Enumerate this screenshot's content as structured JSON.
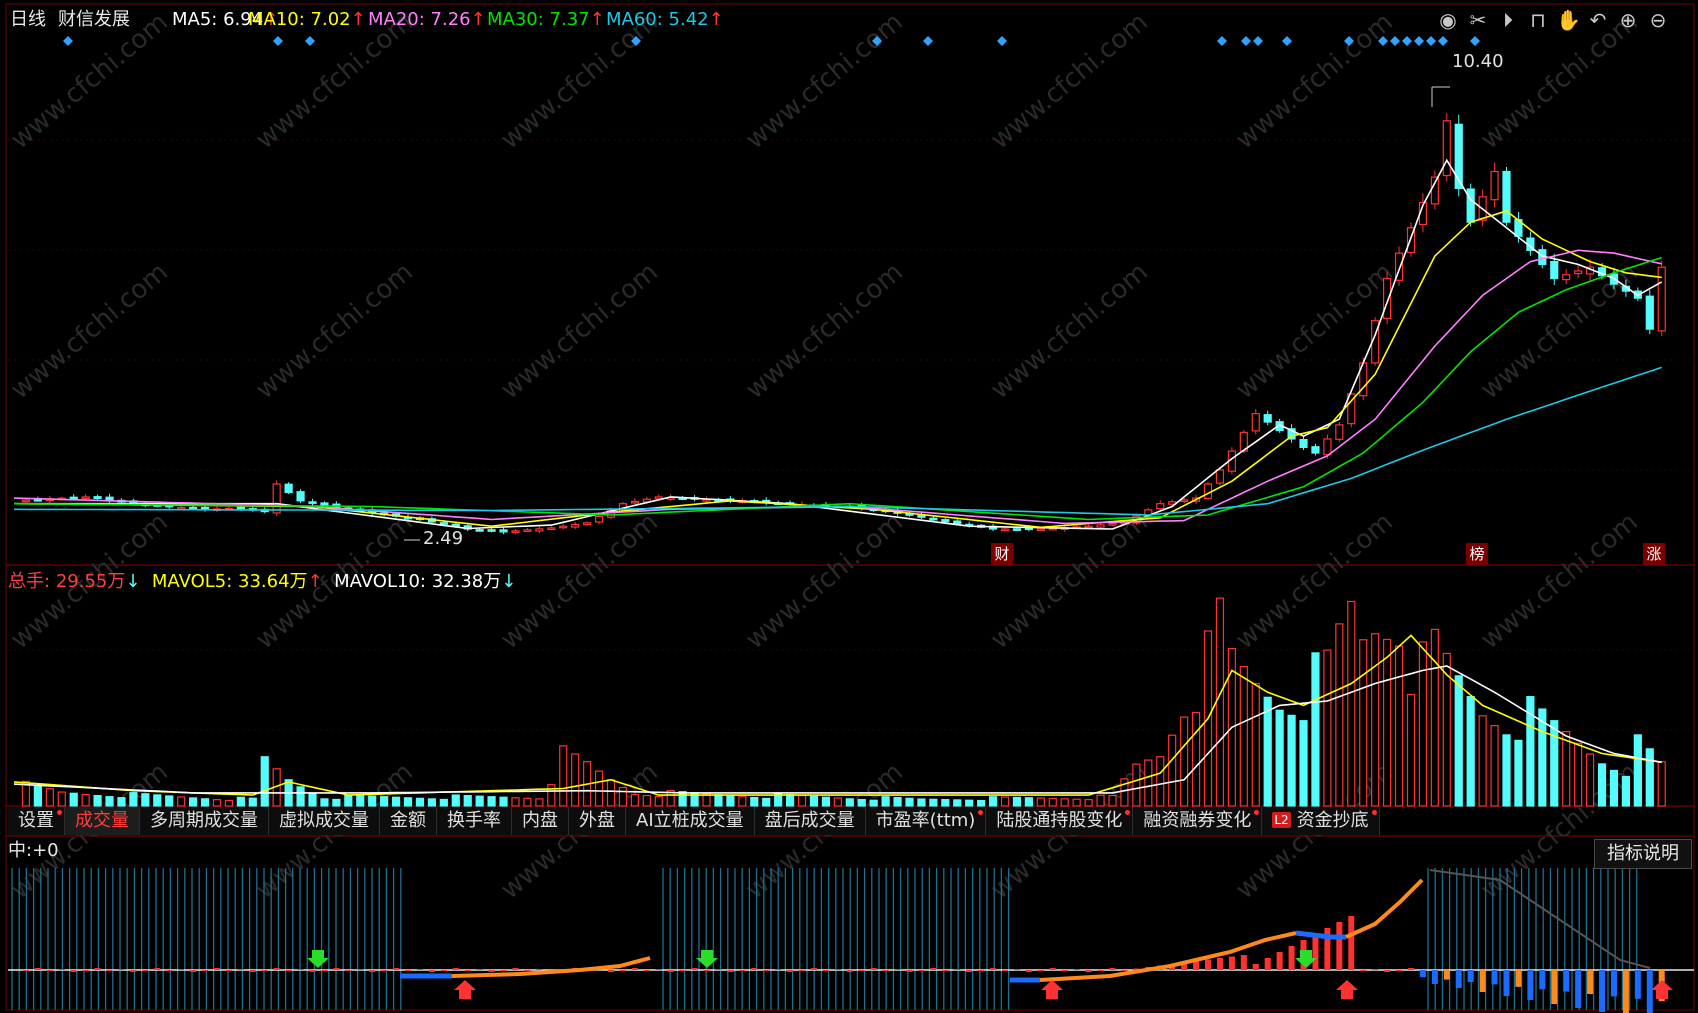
{
  "header": {
    "period": "日线",
    "stock_name": "财信发展",
    "ma5_label": "MA5:",
    "ma5_value": "6.94",
    "ma5_arrow": "↑",
    "ma10_label": "MA10:",
    "ma10_value": "7.02",
    "ma10_arrow": "↑",
    "ma20_label": "MA20:",
    "ma20_value": "7.26",
    "ma20_arrow": "↑",
    "ma30_label": "MA30:",
    "ma30_value": "7.37",
    "ma30_arrow": "↑",
    "ma60_label": "MA60:",
    "ma60_value": "5.42",
    "ma60_arrow": "↑"
  },
  "toolbar": [
    "eye-icon",
    "scissors-icon",
    "play-icon",
    "lock-icon",
    "hand-icon",
    "undo-icon",
    "zoom-in-icon",
    "zoom-out-icon"
  ],
  "price_panel": {
    "high_label": "10.40",
    "low_label": "2.49",
    "badge_cai": "财",
    "badge_bang": "榜",
    "badge_zhang": "涨"
  },
  "volume_header": {
    "total_label": "总手:",
    "total_value": "29.55万",
    "total_arrow": "↓",
    "mavol5_label": "MAVOL5:",
    "mavol5_value": "33.64万",
    "mavol5_arrow": "↑",
    "mavol10_label": "MAVOL10:",
    "mavol10_value": "32.38万",
    "mavol10_arrow": "↓"
  },
  "tabs": [
    {
      "label": "设置",
      "dot": true
    },
    {
      "label": "成交量",
      "active": true
    },
    {
      "label": "多周期成交量"
    },
    {
      "label": "虚拟成交量"
    },
    {
      "label": "金额"
    },
    {
      "label": "换手率"
    },
    {
      "label": "内盘"
    },
    {
      "label": "外盘"
    },
    {
      "label": "AI立桩成交量"
    },
    {
      "label": "盘后成交量"
    },
    {
      "label": "市盈率(ttm)",
      "dot": true
    },
    {
      "label": "陆股通持股变化",
      "dot": true
    },
    {
      "label": "融资融券变化",
      "dot": true
    },
    {
      "label": "资金抄底",
      "dot": true,
      "l2": "L2"
    }
  ],
  "indicator": {
    "label": "中:",
    "value": "+0",
    "explain_button": "指标说明"
  },
  "colors": {
    "up": "#ff3232",
    "down": "#54fcfc",
    "ma5": "#ffffff",
    "ma10": "#ffff00",
    "ma20": "#ff80ff",
    "ma30": "#00e600",
    "ma60": "#1ec8e6",
    "diamond": "#2fa4ff",
    "signal_orange": "#ff8a1c",
    "signal_blue": "#1a6cff"
  },
  "chart_data": {
    "type": "candlestick",
    "ohlc_keyframes": [
      [
        0,
        3.05
      ],
      [
        6,
        3.12
      ],
      [
        12,
        2.96
      ],
      [
        16,
        2.9
      ],
      [
        19,
        2.92
      ],
      [
        21,
        2.86
      ],
      [
        22,
        3.35
      ],
      [
        24,
        3.05
      ],
      [
        28,
        2.9
      ],
      [
        34,
        2.72
      ],
      [
        38,
        2.55
      ],
      [
        41,
        2.5
      ],
      [
        45,
        2.57
      ],
      [
        48,
        2.66
      ],
      [
        51,
        3.0
      ],
      [
        54,
        3.12
      ],
      [
        57,
        3.08
      ],
      [
        61,
        3.05
      ],
      [
        66,
        2.98
      ],
      [
        70,
        2.95
      ],
      [
        75,
        2.8
      ],
      [
        78,
        2.68
      ],
      [
        82,
        2.55
      ],
      [
        86,
        2.55
      ],
      [
        90,
        2.6
      ],
      [
        93,
        2.67
      ],
      [
        96,
        3.0
      ],
      [
        99,
        3.1
      ],
      [
        101,
        3.6
      ],
      [
        104,
        4.6
      ],
      [
        106,
        4.3
      ],
      [
        108,
        4.0
      ],
      [
        109,
        3.9
      ],
      [
        111,
        4.4
      ],
      [
        113,
        5.5
      ],
      [
        115,
        7.0
      ],
      [
        117,
        7.9
      ],
      [
        119,
        8.8
      ],
      [
        120,
        9.8
      ],
      [
        121,
        8.6
      ],
      [
        122,
        8.0
      ],
      [
        124,
        8.9
      ],
      [
        125,
        8.0
      ],
      [
        127,
        7.5
      ],
      [
        129,
        7.0
      ],
      [
        132,
        7.2
      ],
      [
        134,
        6.9
      ],
      [
        136,
        6.65
      ],
      [
        137,
        6.1
      ],
      [
        138,
        7.2
      ]
    ],
    "n_bars": 138,
    "price_range": [
      2.0,
      11.2
    ],
    "labels": {
      "max": 10.4,
      "min": 2.49
    },
    "ma_lines": {
      "MA5": [
        [
          0,
          3.0
        ],
        [
          22,
          3.0
        ],
        [
          38,
          2.56
        ],
        [
          45,
          2.62
        ],
        [
          55,
          3.12
        ],
        [
          65,
          3.0
        ],
        [
          80,
          2.6
        ],
        [
          92,
          2.55
        ],
        [
          97,
          2.95
        ],
        [
          102,
          3.8
        ],
        [
          106,
          4.4
        ],
        [
          108,
          4.2
        ],
        [
          111,
          4.5
        ],
        [
          114,
          6.0
        ],
        [
          118,
          8.3
        ],
        [
          120,
          9.1
        ],
        [
          122,
          8.4
        ],
        [
          125,
          7.9
        ],
        [
          128,
          7.4
        ],
        [
          131,
          7.25
        ],
        [
          134,
          7.0
        ],
        [
          136,
          6.7
        ],
        [
          138,
          6.94
        ]
      ],
      "MA10": [
        [
          0,
          3.0
        ],
        [
          25,
          2.95
        ],
        [
          40,
          2.6
        ],
        [
          50,
          2.85
        ],
        [
          60,
          3.05
        ],
        [
          72,
          2.9
        ],
        [
          86,
          2.58
        ],
        [
          96,
          2.75
        ],
        [
          102,
          3.4
        ],
        [
          107,
          4.2
        ],
        [
          110,
          4.35
        ],
        [
          114,
          5.3
        ],
        [
          119,
          7.4
        ],
        [
          122,
          8.0
        ],
        [
          125,
          8.2
        ],
        [
          128,
          7.7
        ],
        [
          132,
          7.3
        ],
        [
          135,
          7.1
        ],
        [
          138,
          7.02
        ]
      ],
      "MA20": [
        [
          0,
          3.1
        ],
        [
          25,
          2.95
        ],
        [
          40,
          2.72
        ],
        [
          55,
          2.9
        ],
        [
          70,
          2.95
        ],
        [
          88,
          2.65
        ],
        [
          98,
          2.7
        ],
        [
          105,
          3.4
        ],
        [
          110,
          3.85
        ],
        [
          114,
          4.5
        ],
        [
          119,
          5.8
        ],
        [
          123,
          6.7
        ],
        [
          127,
          7.3
        ],
        [
          131,
          7.5
        ],
        [
          134,
          7.45
        ],
        [
          138,
          7.26
        ]
      ],
      "MA30": [
        [
          0,
          3.0
        ],
        [
          30,
          2.95
        ],
        [
          50,
          2.8
        ],
        [
          70,
          3.0
        ],
        [
          90,
          2.72
        ],
        [
          100,
          2.8
        ],
        [
          108,
          3.3
        ],
        [
          113,
          3.9
        ],
        [
          118,
          4.8
        ],
        [
          122,
          5.7
        ],
        [
          126,
          6.4
        ],
        [
          130,
          6.8
        ],
        [
          134,
          7.1
        ],
        [
          138,
          7.37
        ]
      ],
      "MA60": [
        [
          0,
          2.9
        ],
        [
          40,
          2.88
        ],
        [
          70,
          2.95
        ],
        [
          95,
          2.8
        ],
        [
          105,
          3.0
        ],
        [
          112,
          3.45
        ],
        [
          118,
          3.95
        ],
        [
          125,
          4.5
        ],
        [
          132,
          5.0
        ],
        [
          138,
          5.42
        ]
      ]
    },
    "volume_keyframes": [
      [
        0,
        0.5
      ],
      [
        4,
        0.3
      ],
      [
        20,
        0.15
      ],
      [
        21,
        1.0
      ],
      [
        23,
        0.6
      ],
      [
        26,
        0.2
      ],
      [
        44,
        0.2
      ],
      [
        46,
        1.1
      ],
      [
        48,
        0.9
      ],
      [
        52,
        0.3
      ],
      [
        76,
        0.15
      ],
      [
        92,
        0.2
      ],
      [
        94,
        0.9
      ],
      [
        96,
        1.2
      ],
      [
        98,
        2.5
      ],
      [
        100,
        3.2
      ],
      [
        101,
        4.2
      ],
      [
        102,
        3.2
      ],
      [
        104,
        2.8
      ],
      [
        106,
        2.5
      ],
      [
        108,
        2.6
      ],
      [
        110,
        3.0
      ],
      [
        112,
        4.4
      ],
      [
        113,
        3.8
      ],
      [
        114,
        4.2
      ],
      [
        116,
        4.5
      ],
      [
        117,
        3.4
      ],
      [
        118,
        3.0
      ],
      [
        119,
        3.4
      ],
      [
        121,
        2.8
      ],
      [
        123,
        2.2
      ],
      [
        125,
        2.0
      ],
      [
        127,
        2.0
      ],
      [
        130,
        1.6
      ],
      [
        133,
        1.1
      ],
      [
        135,
        0.9
      ],
      [
        136,
        1.3
      ],
      [
        138,
        0.9
      ]
    ],
    "volume_range": [
      0,
      4.8
    ],
    "mavol5": [
      [
        0,
        0.55
      ],
      [
        10,
        0.35
      ],
      [
        20,
        0.25
      ],
      [
        23,
        0.55
      ],
      [
        28,
        0.25
      ],
      [
        46,
        0.4
      ],
      [
        50,
        0.6
      ],
      [
        54,
        0.25
      ],
      [
        90,
        0.25
      ],
      [
        96,
        0.75
      ],
      [
        100,
        2.0
      ],
      [
        102,
        3.1
      ],
      [
        105,
        2.6
      ],
      [
        108,
        2.3
      ],
      [
        112,
        2.8
      ],
      [
        115,
        3.4
      ],
      [
        117,
        3.9
      ],
      [
        120,
        3.0
      ],
      [
        123,
        2.3
      ],
      [
        128,
        1.7
      ],
      [
        133,
        1.2
      ],
      [
        138,
        1.0
      ]
    ],
    "mavol10": [
      [
        0,
        0.5
      ],
      [
        15,
        0.3
      ],
      [
        30,
        0.3
      ],
      [
        48,
        0.35
      ],
      [
        56,
        0.3
      ],
      [
        92,
        0.3
      ],
      [
        98,
        0.6
      ],
      [
        102,
        1.8
      ],
      [
        106,
        2.3
      ],
      [
        110,
        2.4
      ],
      [
        114,
        2.8
      ],
      [
        118,
        3.1
      ],
      [
        120,
        3.2
      ],
      [
        124,
        2.6
      ],
      [
        130,
        1.6
      ],
      [
        134,
        1.2
      ],
      [
        138,
        1.0
      ]
    ],
    "signal_markers": {
      "green_down": [
        25,
        56,
        104
      ],
      "red_up": [
        37,
        84,
        107,
        137
      ]
    }
  }
}
